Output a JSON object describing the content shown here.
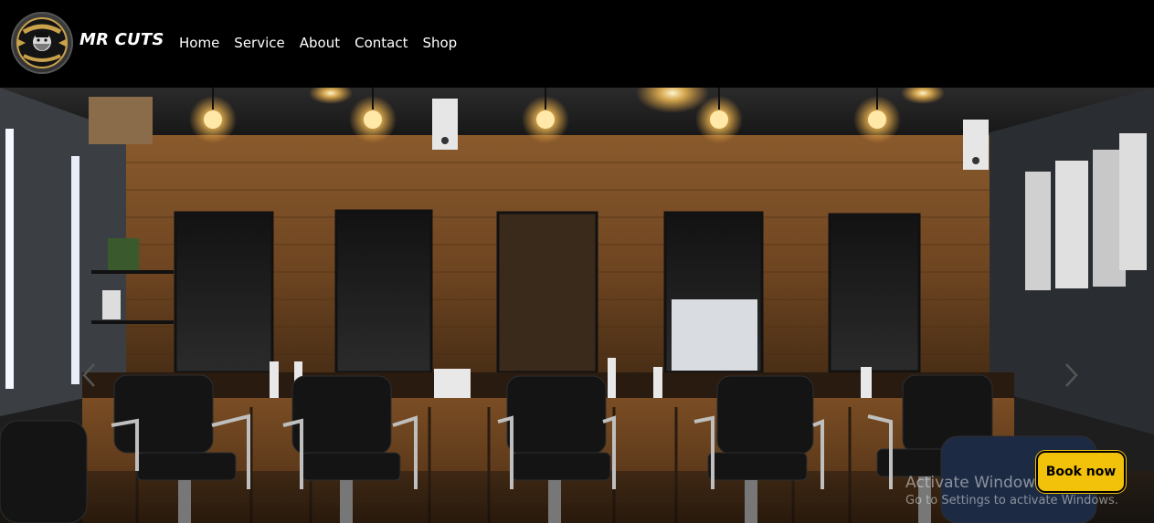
{
  "header": {
    "brand_name": "MR CUTS",
    "logo_text_top": "BARBER",
    "logo_text_bottom": "SHOP",
    "nav": [
      {
        "label": "Home"
      },
      {
        "label": "Service"
      },
      {
        "label": "About"
      },
      {
        "label": "Contact"
      },
      {
        "label": "Shop"
      }
    ]
  },
  "hero": {
    "image_alt": "barbershop interior",
    "prev_icon": "chevron-left-icon",
    "next_icon": "chevron-right-icon"
  },
  "watermark": {
    "title": "Activate Windows",
    "subtitle": "Go to Settings to activate Windows."
  },
  "cta": {
    "book_label": "Book now",
    "color": "#f2c10a"
  }
}
